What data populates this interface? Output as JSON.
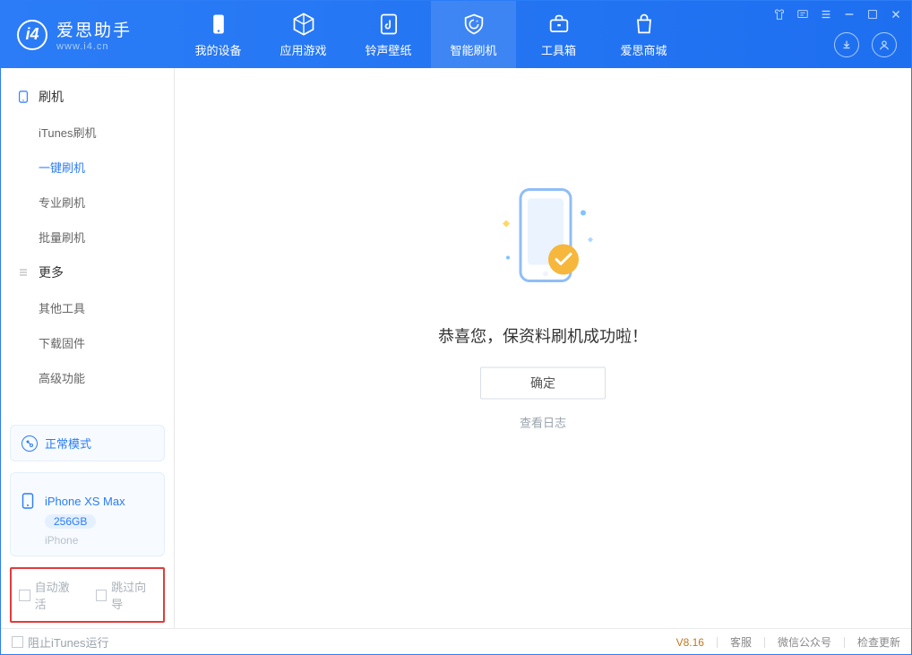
{
  "app": {
    "title": "爱思助手",
    "domain": "www.i4.cn"
  },
  "tabs": [
    {
      "label": "我的设备"
    },
    {
      "label": "应用游戏"
    },
    {
      "label": "铃声壁纸"
    },
    {
      "label": "智能刷机"
    },
    {
      "label": "工具箱"
    },
    {
      "label": "爱思商城"
    }
  ],
  "sidebar": {
    "group1": {
      "label": "刷机"
    },
    "items1": [
      {
        "label": "iTunes刷机"
      },
      {
        "label": "一键刷机"
      },
      {
        "label": "专业刷机"
      },
      {
        "label": "批量刷机"
      }
    ],
    "group2": {
      "label": "更多"
    },
    "items2": [
      {
        "label": "其他工具"
      },
      {
        "label": "下载固件"
      },
      {
        "label": "高级功能"
      }
    ]
  },
  "device": {
    "mode": "正常模式",
    "name": "iPhone XS Max",
    "storage": "256GB",
    "type": "iPhone"
  },
  "options": {
    "auto_activate": "自动激活",
    "skip_guide": "跳过向导"
  },
  "main": {
    "success_text": "恭喜您，保资料刷机成功啦！",
    "ok_label": "确定",
    "log_link": "查看日志"
  },
  "status": {
    "block_itunes": "阻止iTunes运行",
    "version": "V8.16",
    "links": [
      "客服",
      "微信公众号",
      "检查更新"
    ]
  }
}
